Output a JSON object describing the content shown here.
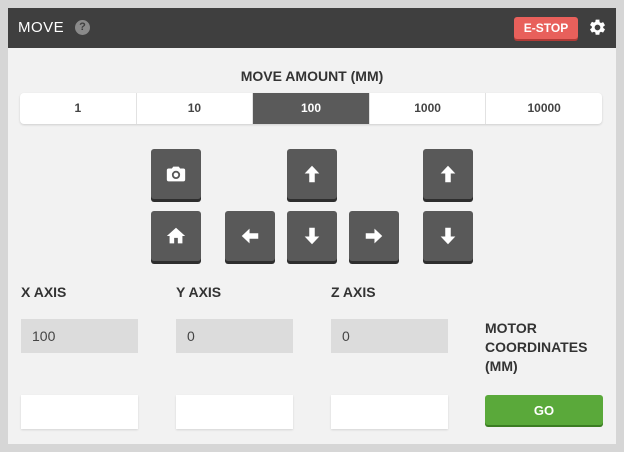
{
  "header": {
    "title": "MOVE",
    "help_glyph": "?",
    "estop_label": "E-STOP",
    "settings_icon": "gear-icon"
  },
  "move_amount": {
    "label": "MOVE AMOUNT (MM)",
    "options": [
      "1",
      "10",
      "100",
      "1000",
      "10000"
    ],
    "selected": "100"
  },
  "jog": {
    "icons": [
      "camera-icon",
      "arrow-up-icon",
      "arrow-up-icon",
      "home-icon",
      "arrow-left-icon",
      "arrow-down-icon",
      "arrow-right-icon",
      "arrow-down-icon"
    ]
  },
  "axes": {
    "x": {
      "label": "X AXIS",
      "value": "100"
    },
    "y": {
      "label": "Y AXIS",
      "value": "0"
    },
    "z": {
      "label": "Z AXIS",
      "value": "0"
    }
  },
  "motor": {
    "label": "MOTOR COORDINATES (MM)",
    "go_label": "GO"
  },
  "colors": {
    "header_bg": "#3f3f3f",
    "estop": "#e8605b",
    "go": "#5aa93a",
    "active_segment": "#5a5a5a"
  }
}
